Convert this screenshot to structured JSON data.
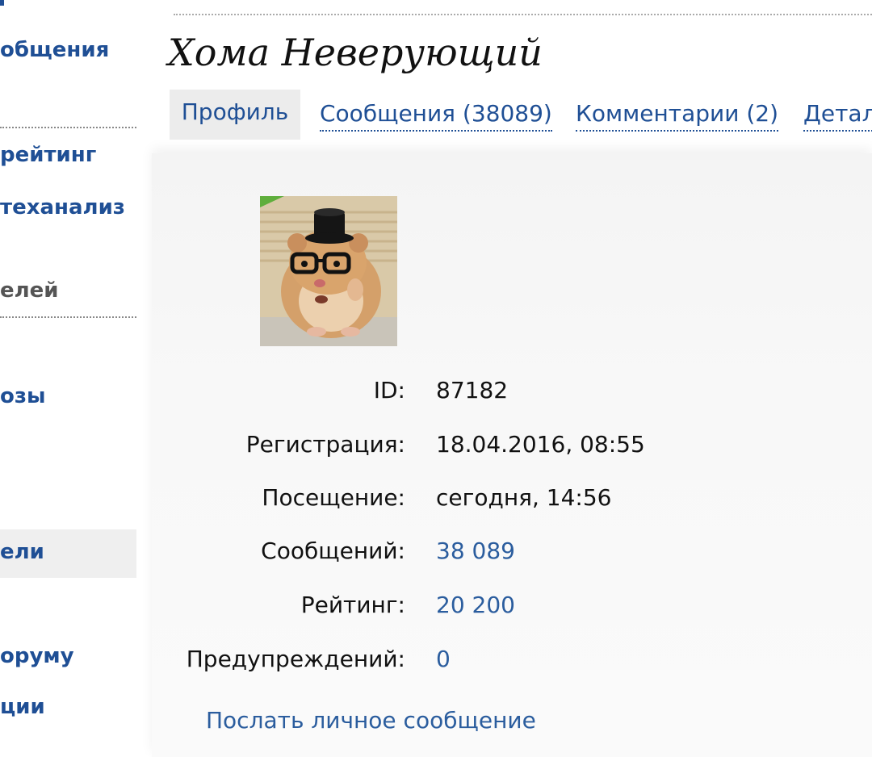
{
  "sidebar": {
    "items": [
      {
        "label": "общения"
      },
      {
        "label": "рейтинг"
      },
      {
        "label": "теханализ"
      },
      {
        "label": "елей"
      },
      {
        "label": "озы"
      },
      {
        "label": "ели"
      },
      {
        "label": "оруму"
      },
      {
        "label": "ции"
      }
    ]
  },
  "profile": {
    "name": "Хома Неверующий",
    "tabs": [
      {
        "label": "Профиль"
      },
      {
        "label": "Сообщения (38089)"
      },
      {
        "label": "Комментарии (2)"
      },
      {
        "label": "Детал"
      }
    ],
    "fields": [
      {
        "label": "ID:",
        "value": "87182"
      },
      {
        "label": "Регистрация:",
        "value": "18.04.2016, 08:55"
      },
      {
        "label": "Посещение:",
        "value": "сегодня, 14:56"
      },
      {
        "label": "Сообщений:",
        "value": "38 089"
      },
      {
        "label": "Рейтинг:",
        "value": "20 200"
      },
      {
        "label": "Предупреждений:",
        "value": "0"
      }
    ],
    "send_message_label": "Послать личное сообщение"
  },
  "colors": {
    "link": "#1f4f95",
    "value_link": "#2b5d9e",
    "panel": "#f6f6f6"
  }
}
